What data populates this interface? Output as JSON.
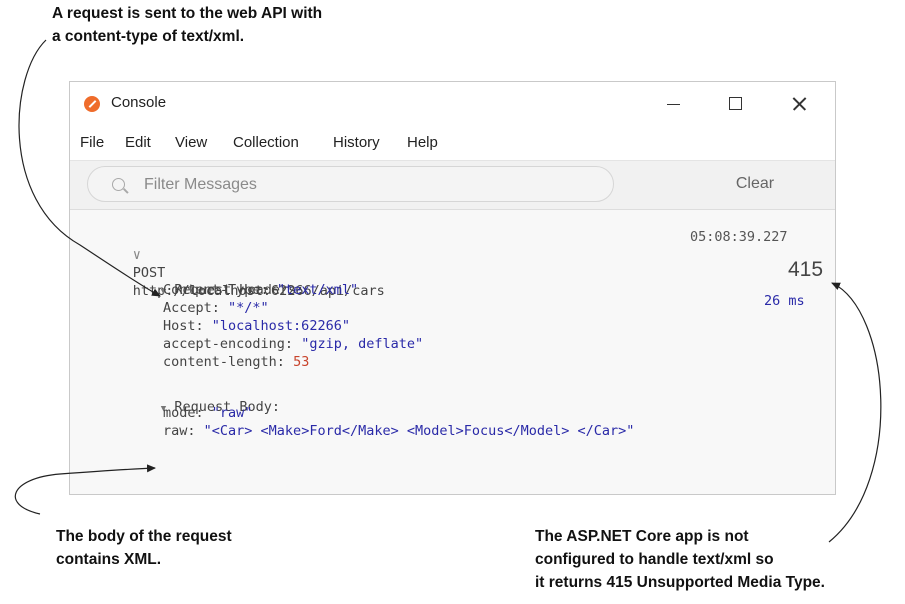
{
  "annotations": {
    "top": [
      "A request is sent to the web API with",
      "a content-type of text/xml."
    ],
    "left": [
      "The body of the request",
      "contains XML."
    ],
    "right": [
      "The ASP.NET Core app is not",
      "configured to handle text/xml so",
      "it returns 415 Unsupported Media Type."
    ]
  },
  "window": {
    "title": "Console",
    "icon": "postman-icon",
    "controls": {
      "minimize": "minimize-icon",
      "maximize": "maximize-icon",
      "close": "close-icon"
    }
  },
  "menu": [
    "File",
    "Edit",
    "View",
    "Collection",
    "History",
    "Help"
  ],
  "filter": {
    "placeholder": "Filter Messages",
    "clear_label": "Clear"
  },
  "request": {
    "method": "POST",
    "url": "http://localhost:62266/api/cars",
    "timestamp": "05:08:39.227",
    "status": "415",
    "duration": "26 ms",
    "headers_label": "Request Headers:",
    "headers": [
      {
        "key": "Content-Type:",
        "value": "\"text/xml\""
      },
      {
        "key": "Accept:",
        "value": "\"*/*\""
      },
      {
        "key": "Host:",
        "value": "\"localhost:62266\""
      },
      {
        "key": "accept-encoding:",
        "value": "\"gzip, deflate\""
      },
      {
        "key": "content-length:",
        "value": "53"
      }
    ],
    "body_label": "Request Body:",
    "body": [
      {
        "key": "mode:",
        "value": "\"raw\""
      },
      {
        "key": "raw:",
        "value": "\"<Car> <Make>Ford</Make> <Model>Focus</Model> </Car>\""
      }
    ]
  },
  "colors": {
    "accent": "#ef6c2b",
    "string": "#2a2aa8",
    "number": "#c8442c"
  }
}
